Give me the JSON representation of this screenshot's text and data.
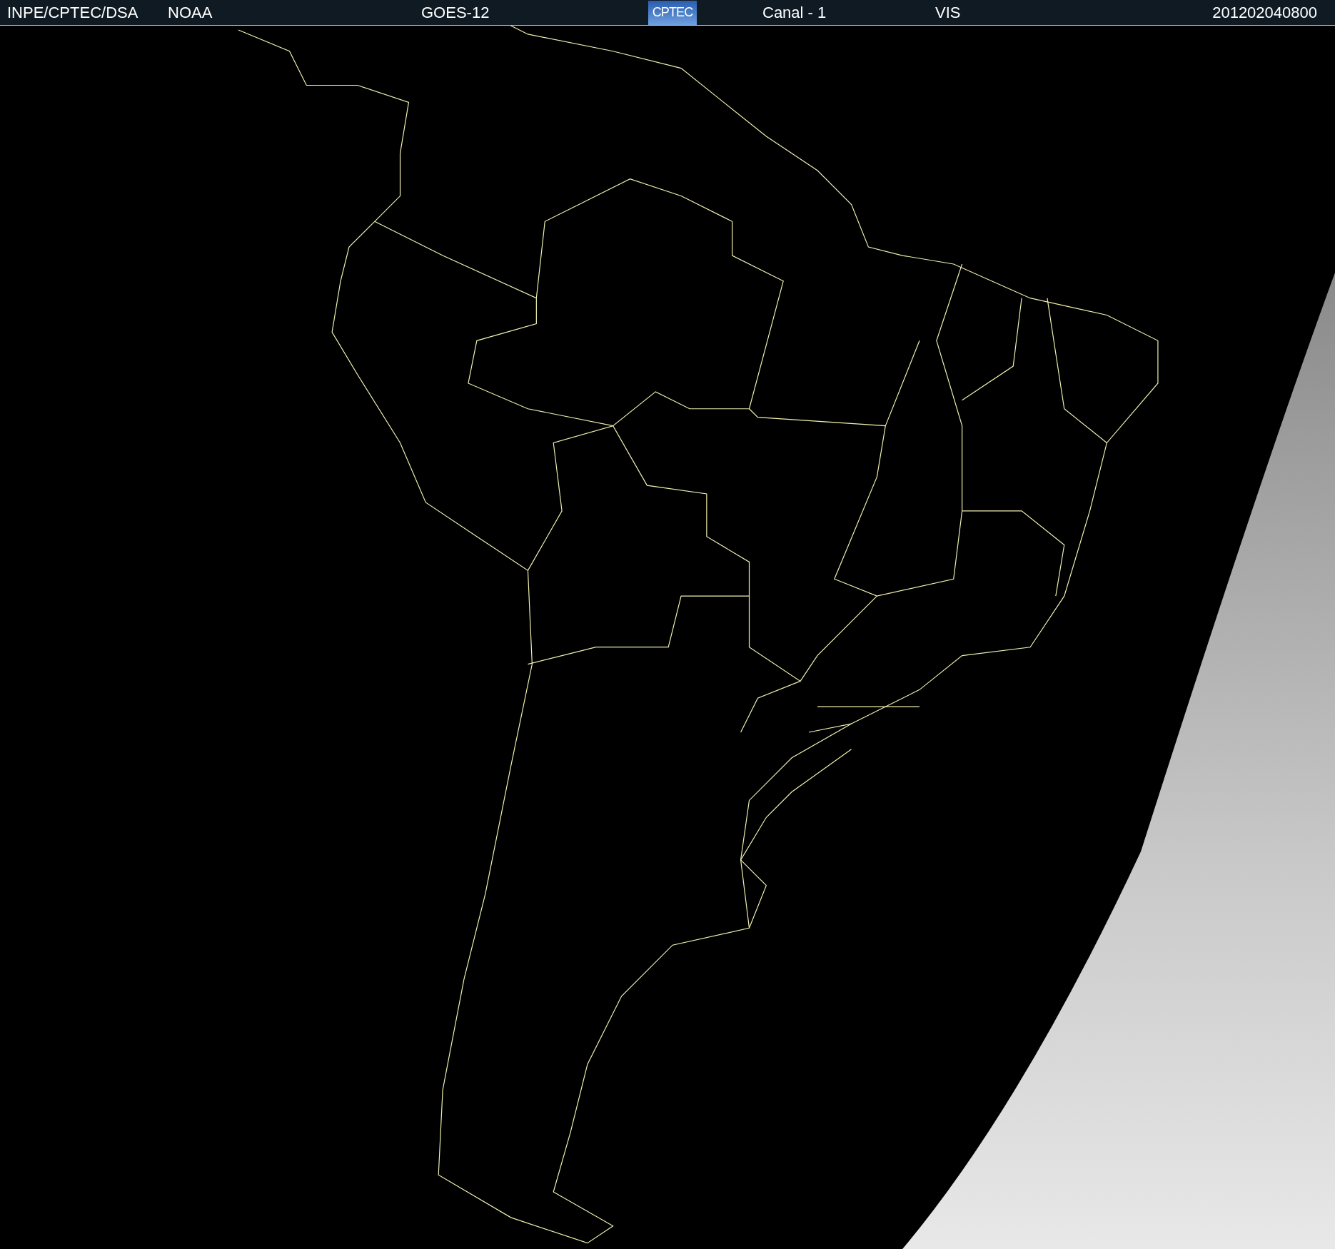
{
  "header": {
    "items": [
      {
        "kind": "text",
        "text": "INPE/CPTEC/DSA"
      },
      {
        "kind": "text",
        "text": "NOAA"
      },
      {
        "kind": "text",
        "text": "GOES-12"
      },
      {
        "kind": "logo",
        "text": "CPTEC"
      },
      {
        "kind": "text",
        "text": "Canal - 1"
      },
      {
        "kind": "text",
        "text": "VIS"
      },
      {
        "kind": "text",
        "text": "201202040800"
      }
    ]
  }
}
